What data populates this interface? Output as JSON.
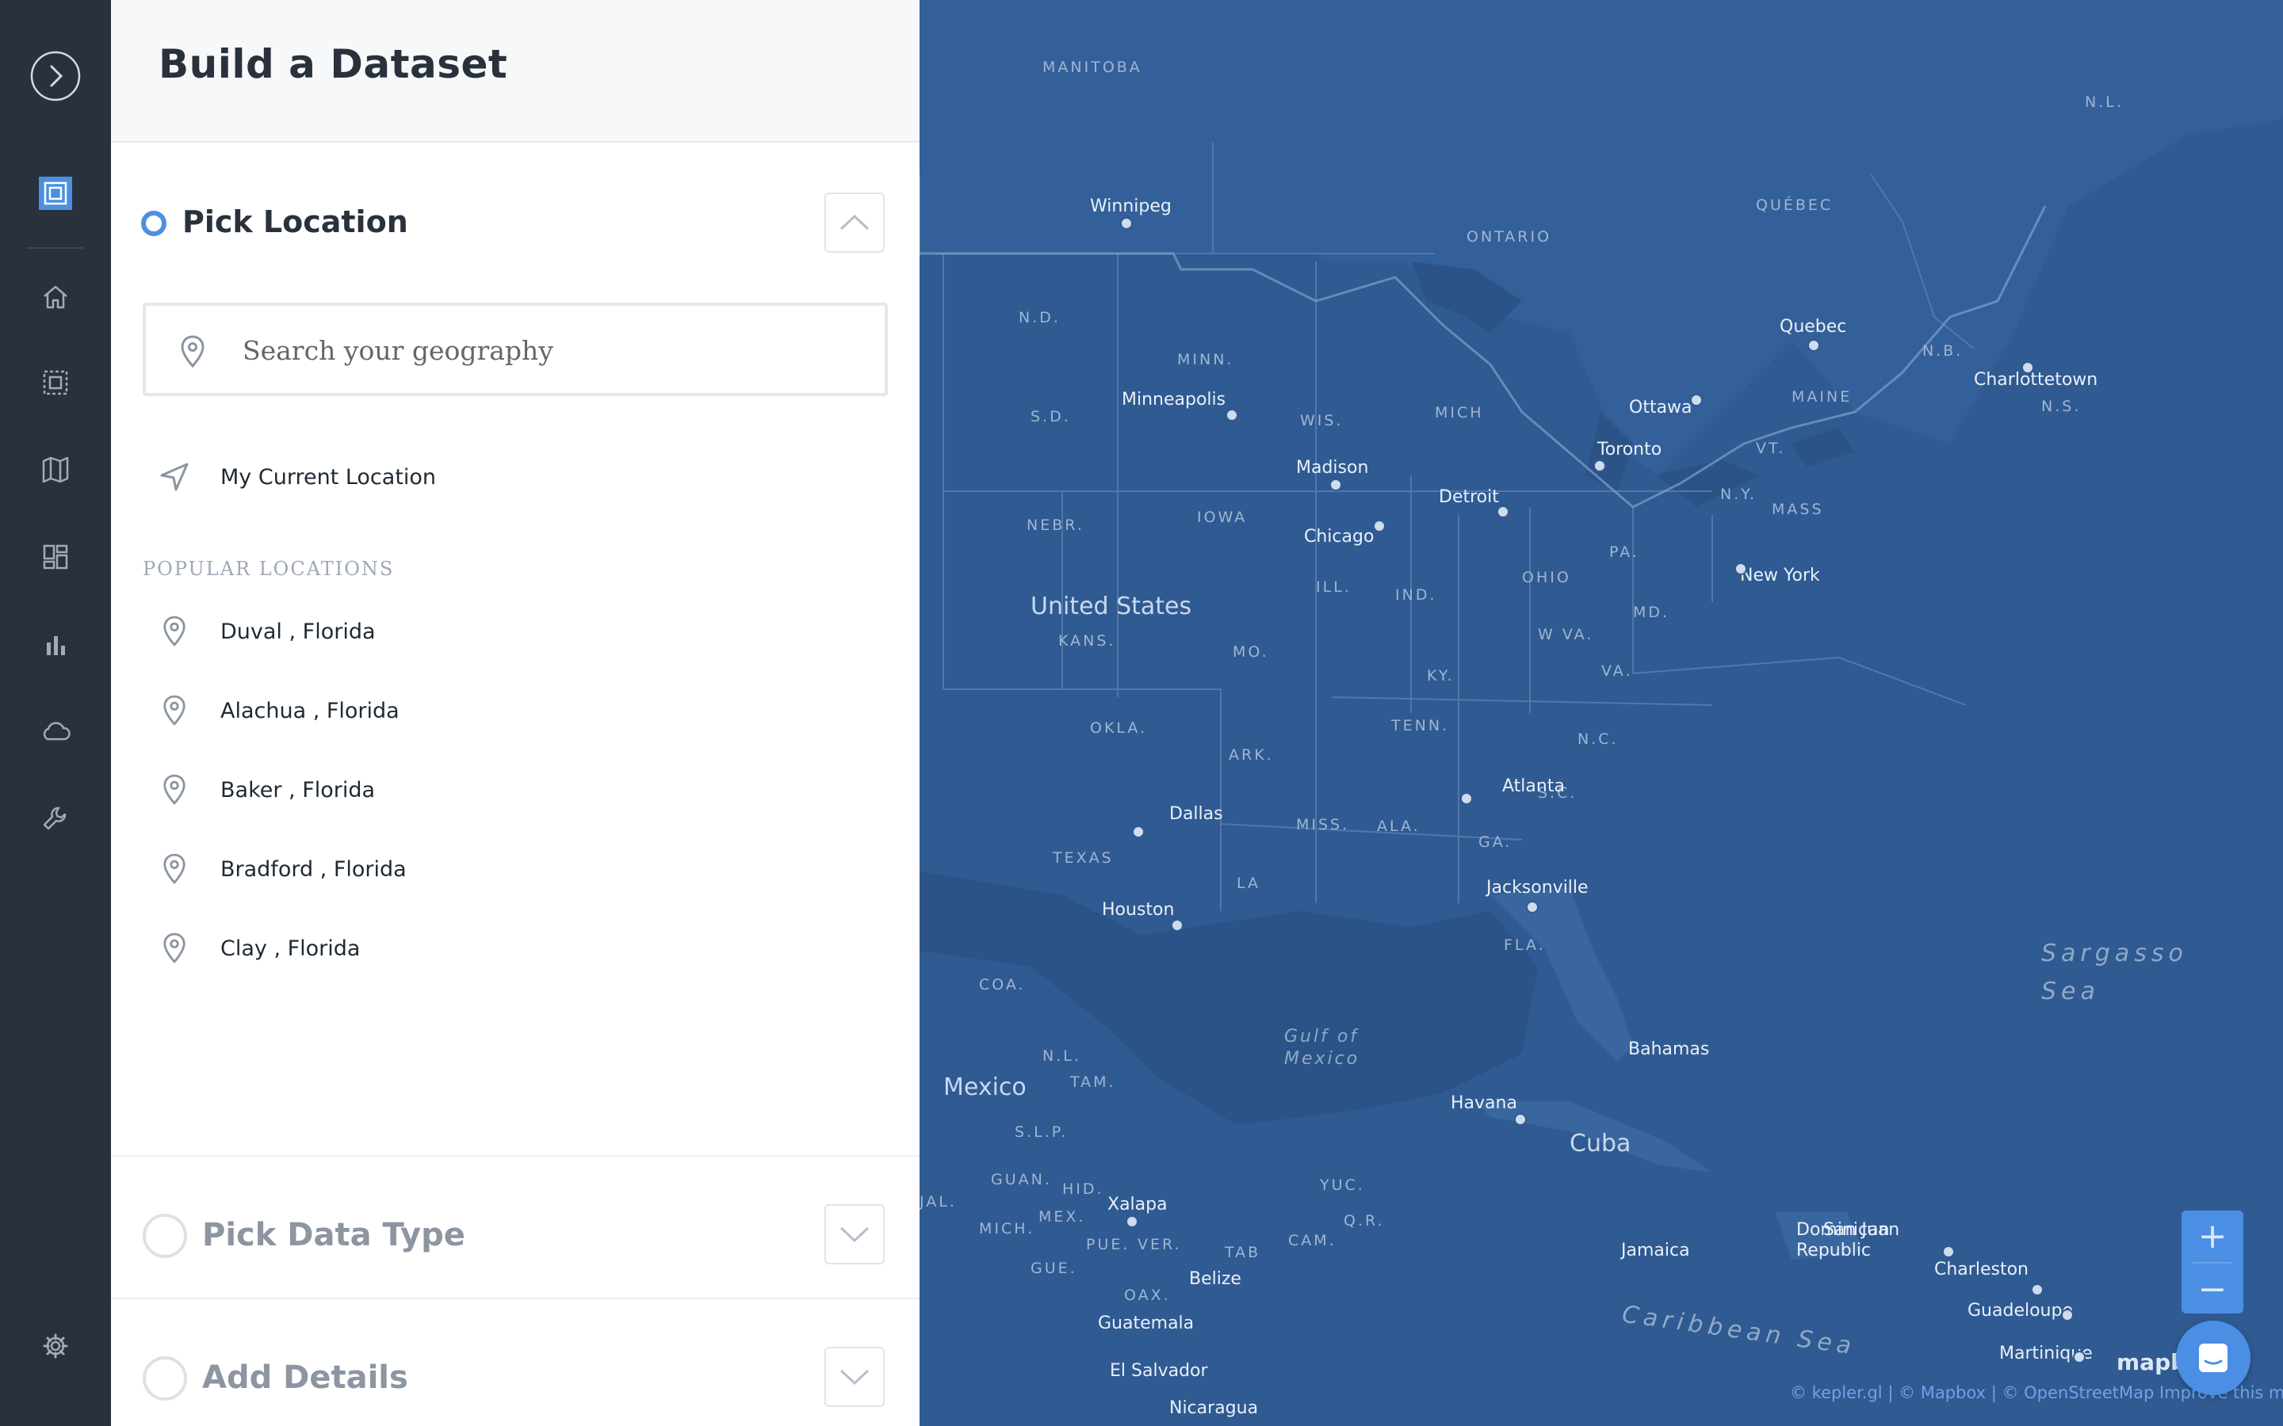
{
  "panel": {
    "title": "Build a Dataset",
    "steps": [
      {
        "label": "Pick Location",
        "active": true
      },
      {
        "label": "Pick Data Type",
        "active": false
      },
      {
        "label": "Add Details",
        "active": false
      }
    ],
    "search": {
      "placeholder": "Search your geography",
      "value": ""
    },
    "current_location_label": "My Current Location",
    "popular_heading": "POPULAR LOCATIONS",
    "popular_locations": [
      "Duval , Florida",
      "Alachua , Florida",
      "Baker , Florida",
      "Bradford , Florida",
      "Clay , Florida"
    ]
  },
  "rail": {
    "items": [
      "expand-icon",
      "brand-logo-icon",
      "home-icon",
      "dataset-icon",
      "map-icon",
      "dashboard-icon",
      "chart-icon",
      "cloud-icon",
      "tools-icon",
      "settings-icon"
    ]
  },
  "map": {
    "cities": [
      "Winnipeg",
      "Minneapolis",
      "Madison",
      "Chicago",
      "Detroit",
      "Ottawa",
      "Toronto",
      "Quebec",
      "Charlottetown",
      "New York",
      "Atlanta",
      "Dallas",
      "Houston",
      "Jacksonville",
      "Havana",
      "San Juan",
      "Charleston",
      "Guadeloupe",
      "Xalapa",
      "Guatemala",
      "El Salvador",
      "Nicaragua",
      "Belize",
      "Bahamas",
      "Jamaica",
      "Dominican Republic",
      "Martinique"
    ],
    "states": [
      "MANITOBA",
      "ONTARIO",
      "QUÉBEC",
      "N.D.",
      "MINN.",
      "S.D.",
      "WIS.",
      "MICH",
      "NEBR.",
      "IOWA",
      "ILL.",
      "IND.",
      "OHIO",
      "PA.",
      "N.Y.",
      "VT.",
      "MAINE",
      "MASS",
      "N.B.",
      "N.S.",
      "N.L.",
      "KANS.",
      "MO.",
      "KY.",
      "W VA.",
      "VA.",
      "MD.",
      "OKLA.",
      "ARK.",
      "TENN.",
      "N.C.",
      "S.C.",
      "TEXAS",
      "MISS.",
      "ALA.",
      "GA.",
      "LA",
      "FLA.",
      "COA.",
      "N.L.",
      "TAM.",
      "S.L.P.",
      "GUAN.",
      "HID.",
      "JAL.",
      "MICH.",
      "MEX.",
      "PUE.",
      "VER.",
      "GUE.",
      "OAX.",
      "TAB",
      "CAM.",
      "YUC.",
      "Q.R."
    ],
    "countries": [
      "United States",
      "Mexico",
      "Cuba"
    ],
    "water": [
      "Gulf of Mexico",
      "Sargasso Sea",
      "Caribbean Sea"
    ],
    "zoom_in": "+",
    "zoom_out": "−",
    "attribution": "© kepler.gl | © Mapbox | © OpenStreetMap  Improve this map",
    "logo_text": "mapbox"
  },
  "colors": {
    "rail_bg": "#29323c",
    "panel_bg": "#ffffff",
    "map_bg": "#2f5a92",
    "accent": "#4a8fe3"
  }
}
